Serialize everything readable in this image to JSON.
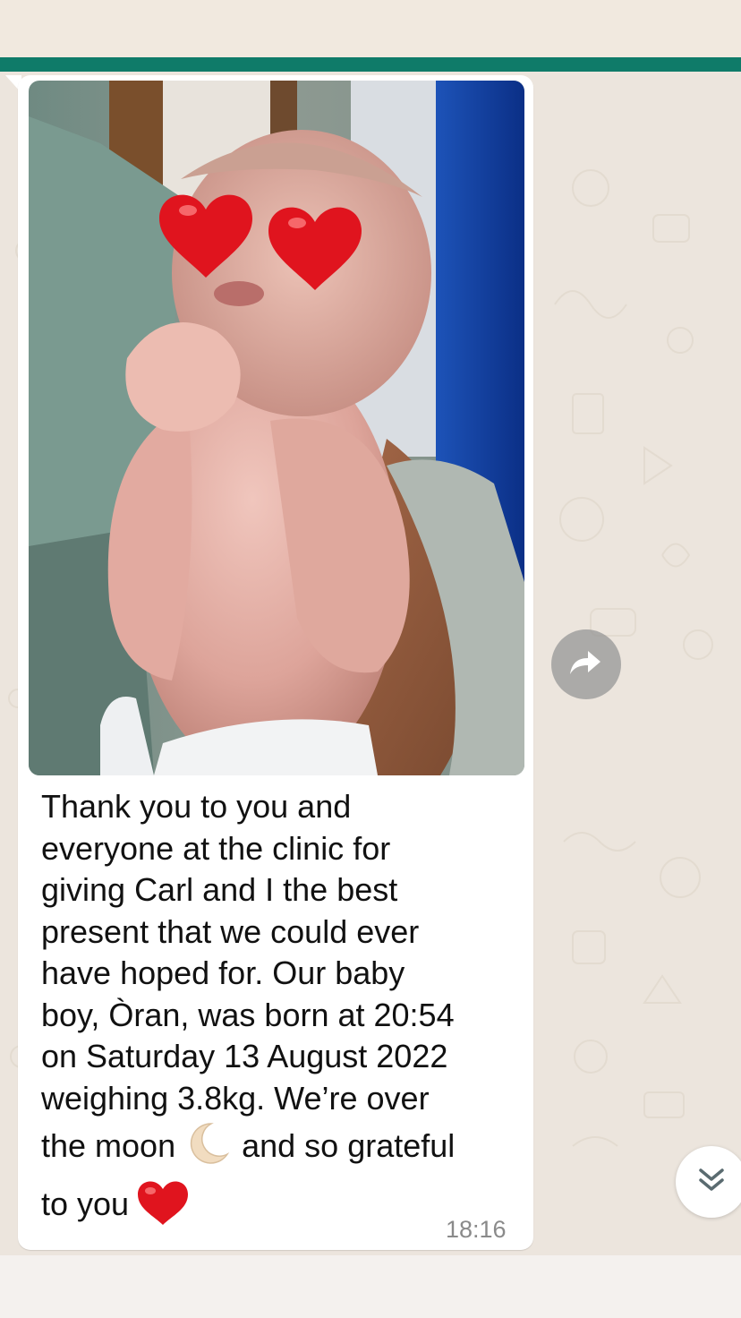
{
  "message": {
    "lines": [
      "Thank you to you and",
      "everyone at the clinic for",
      "giving Carl and I the best",
      "present that we could ever",
      "have hoped for. Our baby",
      "boy, Òran, was born at 20:54",
      "on Saturday 13 August 2022",
      "weighing 3.8kg. We’re over"
    ],
    "line9_before": "the moon ",
    "line9_after": " and so grateful",
    "line10": "to you ",
    "time": "18:16"
  },
  "icons": {
    "forward": "forward-arrow-icon",
    "scroll_down": "double-chevron-down-icon",
    "moon": "crescent-moon-emoji",
    "heart": "red-heart-emoji"
  },
  "colors": {
    "header": "#0f7b69",
    "chat_background": "#ece5dd",
    "bubble": "#ffffff",
    "timestamp": "#8a8a8a",
    "heart": "#e0141e"
  }
}
